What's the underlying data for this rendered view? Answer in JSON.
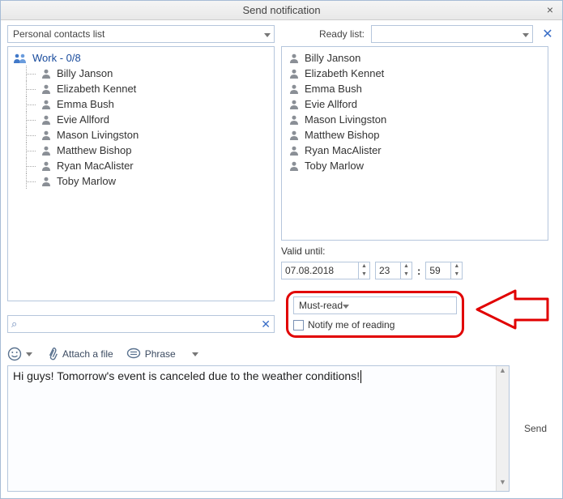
{
  "window": {
    "title": "Send notification"
  },
  "left_dropdown": {
    "label": "Personal contacts list"
  },
  "ready": {
    "label": "Ready list:",
    "value": ""
  },
  "group": {
    "name": "Work",
    "count": "0/8"
  },
  "contacts_left": [
    "Billy Janson",
    "Elizabeth Kennet",
    "Emma Bush",
    "Evie Allford",
    "Mason Livingston",
    "Matthew Bishop",
    "Ryan MacAlister",
    "Toby Marlow"
  ],
  "contacts_right": [
    "Billy Janson",
    "Elizabeth Kennet",
    "Emma Bush",
    "Evie Allford",
    "Mason Livingston",
    "Matthew Bishop",
    "Ryan MacAlister",
    "Toby Marlow"
  ],
  "valid": {
    "label": "Valid until:",
    "date": "07.08.2018",
    "hour": "23",
    "minute": "59"
  },
  "priority": {
    "value": "Must-read"
  },
  "notify": {
    "label": "Notify me of reading"
  },
  "toolbar": {
    "attach_label": "Attach a file",
    "phrase_label": "Phrase"
  },
  "message": {
    "text": "Hi guys! Tomorrow's event is canceled due to the weather conditions!"
  },
  "send": {
    "label": "Send"
  },
  "search": {
    "placeholder": ""
  }
}
